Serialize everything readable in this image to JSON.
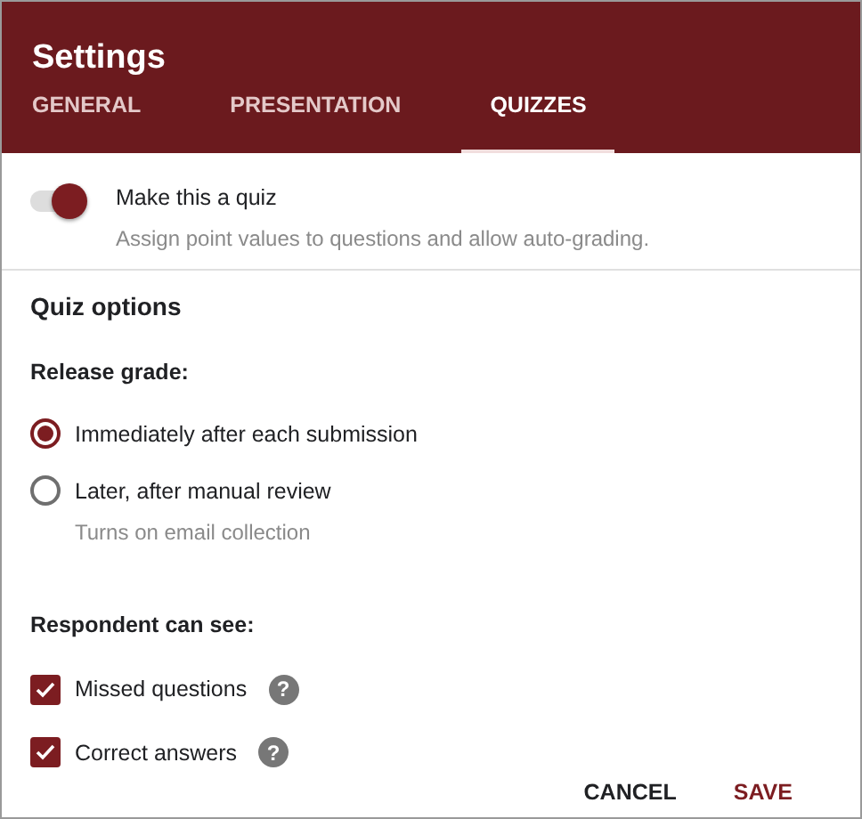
{
  "window": {
    "title": "Settings"
  },
  "tabs": [
    {
      "label": "GENERAL",
      "selected": false
    },
    {
      "label": "PRESENTATION",
      "selected": false
    },
    {
      "label": "QUIZZES",
      "selected": true
    }
  ],
  "quiz_toggle": {
    "label": "Make this a quiz",
    "description": "Assign point values to questions and allow auto-grading.",
    "on": true
  },
  "section_title": "Quiz options",
  "release_grade": {
    "label": "Release grade:",
    "options": [
      {
        "label": "Immediately after each submission",
        "selected": true
      },
      {
        "label": "Later, after manual review",
        "description": "Turns on email collection",
        "selected": false
      }
    ]
  },
  "respondent_can_see": {
    "label": "Respondent can see:",
    "options": [
      {
        "label": "Missed questions",
        "checked": true,
        "help": "?"
      },
      {
        "label": "Correct answers",
        "checked": true,
        "help": "?"
      }
    ]
  },
  "buttons": [
    {
      "label": "CANCEL",
      "kind": "secondary"
    },
    {
      "label": "SAVE",
      "kind": "primary"
    }
  ]
}
